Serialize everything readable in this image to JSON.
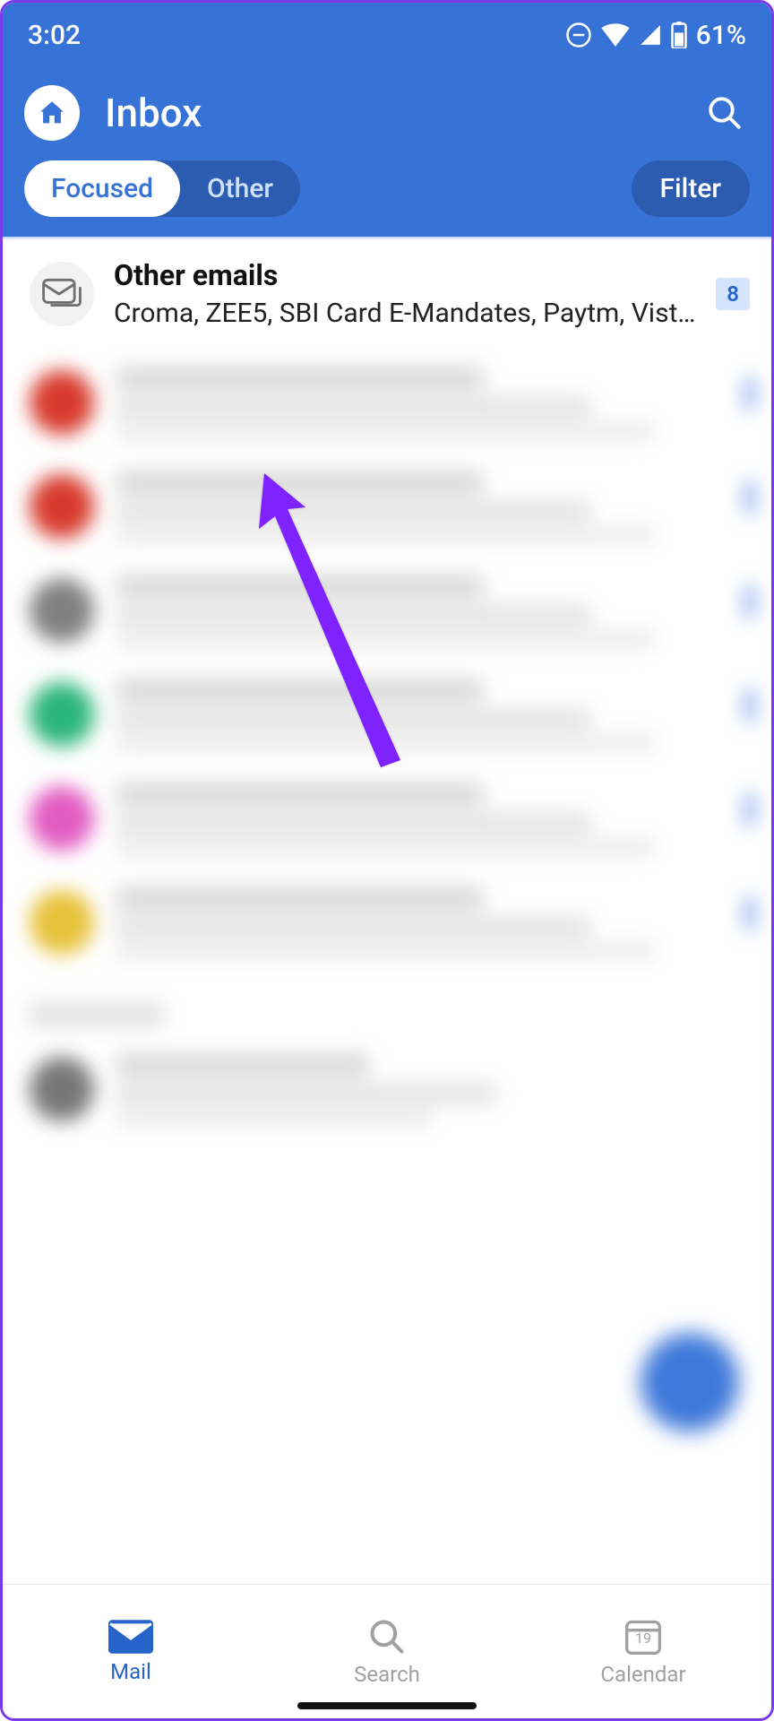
{
  "statusbar": {
    "time": "3:02",
    "battery": "61%"
  },
  "header": {
    "title": "Inbox"
  },
  "tabs": {
    "focused": "Focused",
    "other": "Other",
    "filter": "Filter"
  },
  "other_emails": {
    "title": "Other emails",
    "senders": "Croma, ZEE5, SBI Card E-Mandates, Paytm, Vist…",
    "count": "8"
  },
  "mail_items": [
    {
      "color": "#d83a2d"
    },
    {
      "color": "#d83a2d"
    },
    {
      "color": "#808080"
    },
    {
      "color": "#2bb67a"
    },
    {
      "color": "#e25bc2"
    },
    {
      "color": "#e7c23a"
    }
  ],
  "nav": {
    "mail": "Mail",
    "search": "Search",
    "calendar": "Calendar",
    "cal_day": "19"
  }
}
